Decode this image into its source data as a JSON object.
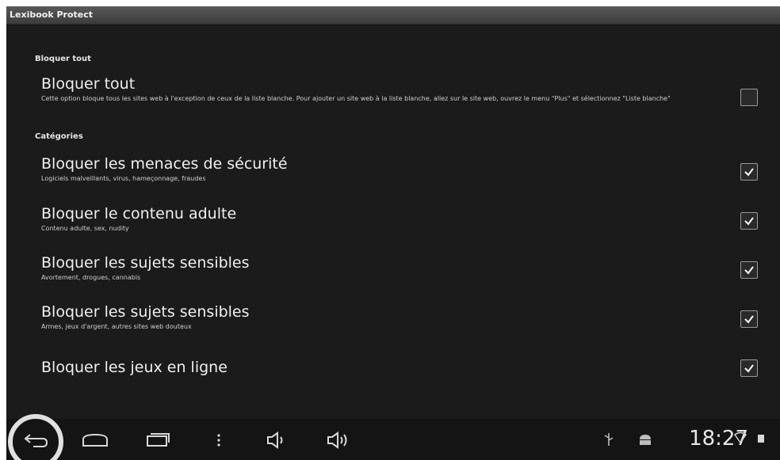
{
  "app": {
    "title": "Lexibook Protect"
  },
  "sections": {
    "block_all_header": "Bloquer tout",
    "categories_header": "Catégories"
  },
  "prefs": [
    {
      "title": "Bloquer tout",
      "summary": "Cette option bloque tous les sites web à l'exception de ceux de la liste blanche. Pour ajouter un site web à la liste blanche, allez sur le site web, ouvrez le menu \"Plus\" et sélectionnez \"Liste blanche\"",
      "checked": false
    },
    {
      "title": "Bloquer les menaces de sécurité",
      "summary": "Logiciels malveillants, virus, hameçonnage, fraudes",
      "checked": true
    },
    {
      "title": "Bloquer le contenu adulte",
      "summary": "Contenu adulte, sex, nudity",
      "checked": true
    },
    {
      "title": "Bloquer les sujets sensibles",
      "summary": "Avortement, drogues, cannabis",
      "checked": true
    },
    {
      "title": "Bloquer les sujets sensibles",
      "summary": "Armes, jeux d'argent, autres sites web douteux",
      "checked": true
    },
    {
      "title": "Bloquer les jeux en ligne",
      "summary": "",
      "checked": true
    }
  ],
  "statusbar": {
    "time": "18:27"
  },
  "icons": {
    "back": "back-icon",
    "home": "home-icon",
    "recent": "recent-apps-icon",
    "menu": "menu-dots-icon",
    "vol_down": "volume-down-icon",
    "vol_up": "volume-up-icon",
    "usb": "usb-icon",
    "android": "android-icon",
    "wifi": "wifi-icon",
    "battery": "battery-icon"
  }
}
